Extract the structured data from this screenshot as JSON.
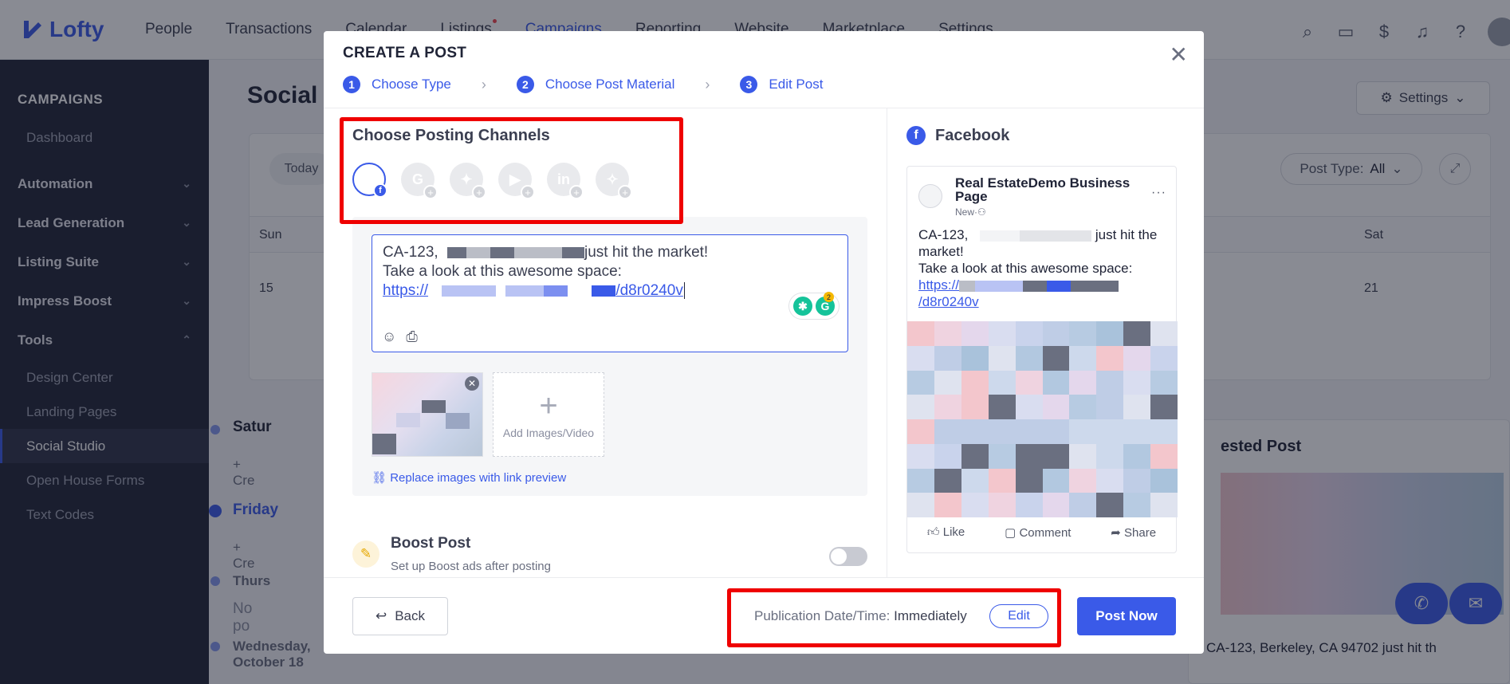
{
  "app": {
    "logo_text": "Lofty",
    "nav": [
      "People",
      "Transactions",
      "Calendar",
      "Listings",
      "Campaigns",
      "Reporting",
      "Website",
      "Marketplace",
      "Settings"
    ]
  },
  "sidebar": {
    "title": "CAMPAIGNS",
    "items": [
      {
        "label": "Dashboard",
        "type": "sub"
      },
      {
        "label": "Automation",
        "type": "group"
      },
      {
        "label": "Lead Generation",
        "type": "group"
      },
      {
        "label": "Listing Suite",
        "type": "group"
      },
      {
        "label": "Impress Boost",
        "type": "group"
      },
      {
        "label": "Tools",
        "type": "group"
      },
      {
        "label": "Design Center",
        "type": "sub"
      },
      {
        "label": "Landing Pages",
        "type": "sub"
      },
      {
        "label": "Social Studio",
        "type": "sub"
      },
      {
        "label": "Open House Forms",
        "type": "sub"
      },
      {
        "label": "Text Codes",
        "type": "sub"
      }
    ]
  },
  "page": {
    "title": "Social",
    "settings_label": "Settings",
    "today_label": "Today",
    "post_type_label": "Post Type:",
    "post_type_value": "All",
    "weekdays": {
      "sun": "Sun",
      "sat": "Sat"
    },
    "days": {
      "sun": "15",
      "sat": "21"
    },
    "timeline": [
      {
        "label": "Satur"
      },
      {
        "label": "+ Cre"
      },
      {
        "label": "Friday"
      },
      {
        "label": "+ Cre"
      },
      {
        "label": "Thurs"
      },
      {
        "label": "No po"
      },
      {
        "label": "Wednesday, October 18"
      }
    ],
    "suggested_title": "ested Post",
    "suggested_text": "CA-123, Berkeley, CA 94702 just hit th"
  },
  "modal": {
    "title": "CREATE A POST",
    "steps": [
      {
        "num": "1",
        "label": "Choose Type"
      },
      {
        "num": "2",
        "label": "Choose Post Material"
      },
      {
        "num": "3",
        "label": "Edit Post"
      }
    ],
    "channels_title": "Choose Posting Channels",
    "post": {
      "line1_a": "CA-123,",
      "line1_b": "just hit the market!",
      "line2": "Take a look at this awesome space:",
      "link_a": "https://",
      "link_b": "/d8r0240v"
    },
    "grammarly_count": "2",
    "add_media_label": "Add Images/Video",
    "replace_link_label": "Replace images with link preview",
    "boost": {
      "title": "Boost Post",
      "subtitle": "Set up Boost ads after posting"
    },
    "preview": {
      "network_label": "Facebook",
      "page_name": "Real EstateDemo Business Page",
      "page_meta": "New·",
      "text_a": "CA-123,",
      "text_b": "just hit the market!",
      "text_c": "Take a look at this awesome space:",
      "link_a": "https://",
      "link_b": "/d8r0240v",
      "actions": [
        "Like",
        "Comment",
        "Share"
      ]
    },
    "footer": {
      "back_label": "Back",
      "pub_label": "Publication Date/Time:",
      "pub_value": "Immediately",
      "edit_label": "Edit",
      "post_now_label": "Post Now"
    }
  },
  "colors": {
    "accent": "#3a5ae8",
    "sidebar_bg": "#202437",
    "highlight": "#ef0000"
  }
}
